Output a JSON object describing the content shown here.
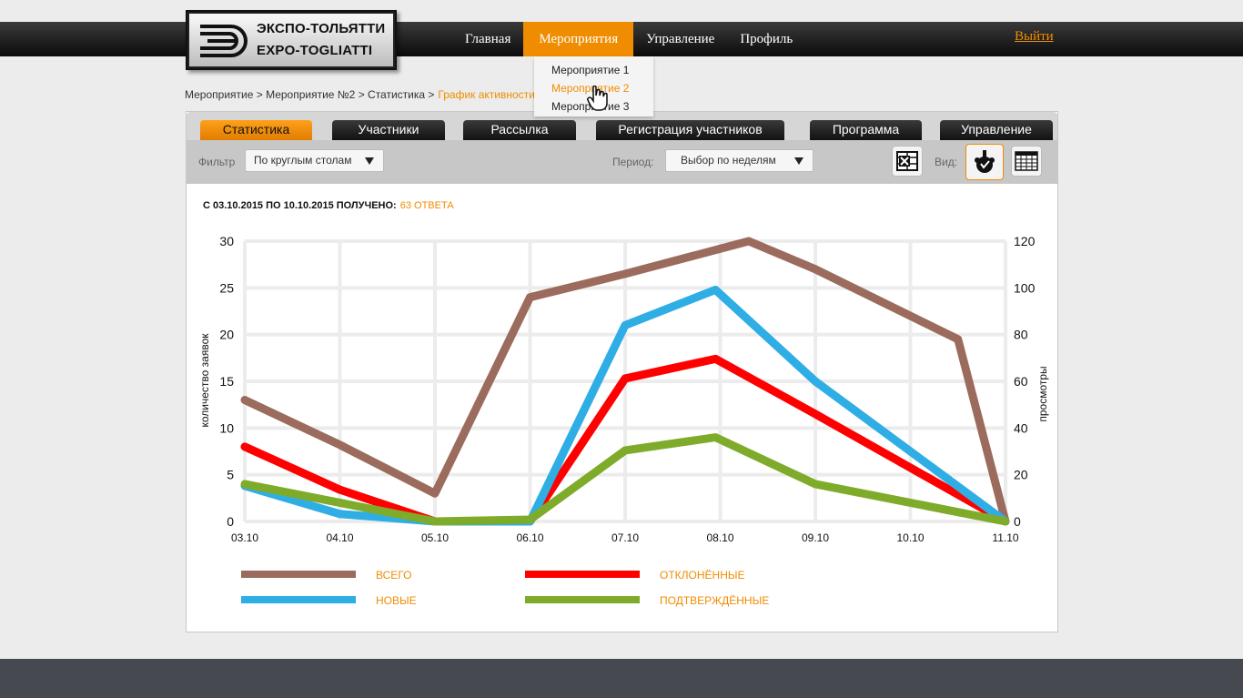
{
  "logo": {
    "line1": "ЭКСПО-ТОЛЬЯТТИ",
    "line2": "EXPO-TOGLIATTI"
  },
  "nav": {
    "items": [
      "Главная",
      "Мероприятия",
      "Управление",
      "Профиль"
    ],
    "logout": "Выйти"
  },
  "dropdown": {
    "items": [
      "Мероприятие 1",
      "Мероприятие 2",
      "Мероприятие 3"
    ]
  },
  "breadcrumb": {
    "path": "Мероприятие > Мероприятие №2 > Статистика >",
    "current": "График активности"
  },
  "tabs": [
    "Статистика",
    "Участники",
    "Рассылка",
    "Регистрация участников",
    "Программа",
    "Управление"
  ],
  "filter": {
    "label": "Фильтр",
    "value": "По круглым столам"
  },
  "period": {
    "label": "Период:",
    "value": "Выбор по неделям"
  },
  "view": {
    "label": "Вид:"
  },
  "summary": {
    "text": "С 03.10.2015 ПО 10.10.2015 ПОЛУЧЕНО:",
    "count": "63 ОТВЕТА"
  },
  "colors": {
    "accent": "#f08c00",
    "total": "#9b6b5d",
    "rejected": "#ff0000",
    "new": "#2eaee5",
    "confirmed": "#7fab2a"
  },
  "chart_data": {
    "type": "line",
    "x": [
      "03.10",
      "04.10",
      "05.10",
      "06.10",
      "07.10",
      "08.10",
      "09.10",
      "10.10",
      "11.10"
    ],
    "ylabel": "количество заявок",
    "y2label": "просмотры",
    "ylim": [
      0,
      30
    ],
    "y_ticks": [
      0,
      5,
      10,
      15,
      20,
      25,
      30
    ],
    "y2lim": [
      0,
      120
    ],
    "y2_ticks": [
      0,
      20,
      40,
      60,
      80,
      100,
      120
    ],
    "grid": true,
    "legend_position": "bottom",
    "series": [
      {
        "name": "ВСЕГО",
        "color": "#9b6b5d",
        "points": [
          [
            0,
            13
          ],
          [
            1.0,
            8.2
          ],
          [
            2.0,
            3.0
          ],
          [
            3.0,
            24
          ],
          [
            4.0,
            26.5
          ],
          [
            5.3,
            30
          ],
          [
            6.0,
            27
          ],
          [
            7.5,
            19.5
          ],
          [
            8.0,
            0
          ]
        ]
      },
      {
        "name": "ОТКЛОНЁННЫЕ",
        "color": "#ff0000",
        "points": [
          [
            0,
            8
          ],
          [
            1.0,
            3.4
          ],
          [
            2.0,
            0
          ],
          [
            3.0,
            0
          ],
          [
            4.0,
            15.3
          ],
          [
            4.95,
            17.4
          ],
          [
            6.0,
            11.5
          ],
          [
            8.0,
            0
          ]
        ]
      },
      {
        "name": "НОВЫЕ",
        "color": "#2eaee5",
        "points": [
          [
            0,
            3.8
          ],
          [
            1.0,
            0.8
          ],
          [
            2.0,
            0
          ],
          [
            3.0,
            0
          ],
          [
            4.0,
            21
          ],
          [
            4.95,
            24.8
          ],
          [
            6.0,
            15
          ],
          [
            8.0,
            0
          ]
        ]
      },
      {
        "name": "ПОДТВЕРЖДЁННЫЕ",
        "color": "#7fab2a",
        "points": [
          [
            0,
            4
          ],
          [
            1.0,
            2
          ],
          [
            2.0,
            0
          ],
          [
            3.0,
            0.2
          ],
          [
            4.0,
            7.6
          ],
          [
            4.95,
            9
          ],
          [
            6.0,
            4
          ],
          [
            8.0,
            0
          ]
        ]
      }
    ]
  }
}
